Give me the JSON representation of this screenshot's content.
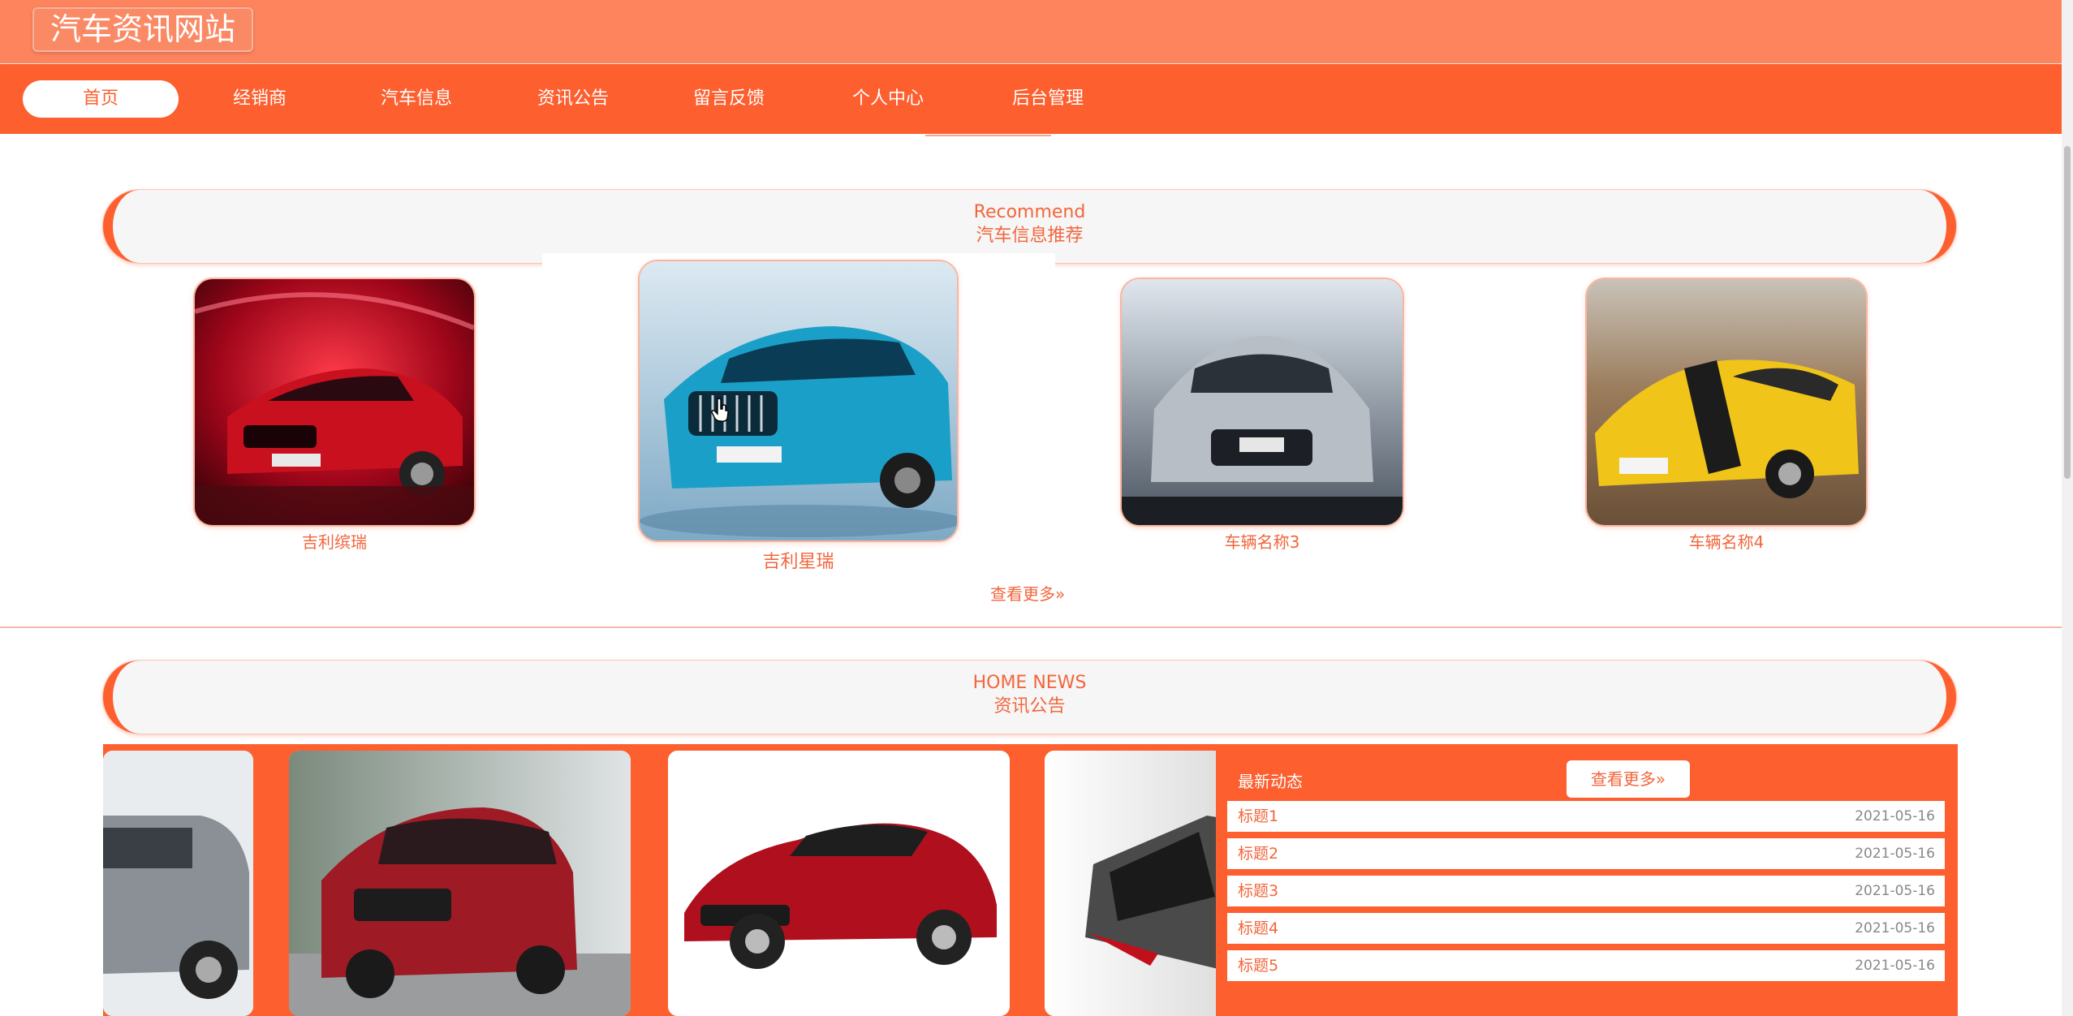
{
  "header": {
    "site_title": "汽车资讯网站"
  },
  "nav": {
    "items": [
      {
        "label": "首页",
        "active": true
      },
      {
        "label": "经销商",
        "active": false
      },
      {
        "label": "汽车信息",
        "active": false
      },
      {
        "label": "资讯公告",
        "active": false
      },
      {
        "label": "留言反馈",
        "active": false
      },
      {
        "label": "个人中心",
        "active": false
      },
      {
        "label": "后台管理",
        "active": false
      }
    ]
  },
  "recommend": {
    "title_en": "Recommend",
    "title_cn": "汽车信息推荐",
    "cars": [
      {
        "name": "吉利缤瑞",
        "image": "red-sedan-photo"
      },
      {
        "name": "吉利星瑞",
        "image": "blue-sedan-photo"
      },
      {
        "name": "车辆名称3",
        "image": "silver-toyota-photo"
      },
      {
        "name": "车辆名称4",
        "image": "yellow-camaro-photo"
      }
    ],
    "more_label": "查看更多"
  },
  "news": {
    "title_en": "HOME NEWS",
    "title_cn": "资讯公告",
    "panel_title": "最新动态",
    "more_label": "查看更多",
    "items": [
      {
        "title": "标题1",
        "date": "2021-05-16"
      },
      {
        "title": "标题2",
        "date": "2021-05-16"
      },
      {
        "title": "标题3",
        "date": "2021-05-16"
      },
      {
        "title": "标题4",
        "date": "2021-05-16"
      },
      {
        "title": "标题5",
        "date": "2021-05-16"
      }
    ]
  },
  "colors": {
    "header_bg": "#fe845e",
    "nav_bg": "#fd5f2f",
    "accent_text": "#f2663c"
  }
}
